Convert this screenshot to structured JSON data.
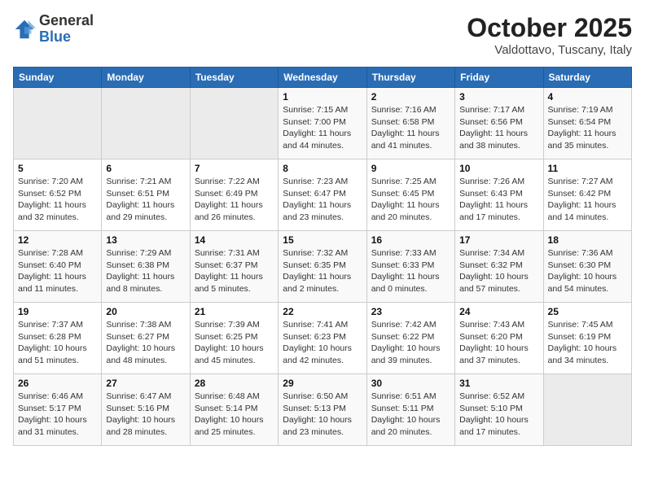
{
  "header": {
    "logo_general": "General",
    "logo_blue": "Blue",
    "month_title": "October 2025",
    "subtitle": "Valdottavo, Tuscany, Italy"
  },
  "days_of_week": [
    "Sunday",
    "Monday",
    "Tuesday",
    "Wednesday",
    "Thursday",
    "Friday",
    "Saturday"
  ],
  "weeks": [
    [
      {
        "day": "",
        "empty": true
      },
      {
        "day": "",
        "empty": true
      },
      {
        "day": "",
        "empty": true
      },
      {
        "day": "1",
        "sunrise": "7:15 AM",
        "sunset": "7:00 PM",
        "daylight": "11 hours and 44 minutes."
      },
      {
        "day": "2",
        "sunrise": "7:16 AM",
        "sunset": "6:58 PM",
        "daylight": "11 hours and 41 minutes."
      },
      {
        "day": "3",
        "sunrise": "7:17 AM",
        "sunset": "6:56 PM",
        "daylight": "11 hours and 38 minutes."
      },
      {
        "day": "4",
        "sunrise": "7:19 AM",
        "sunset": "6:54 PM",
        "daylight": "11 hours and 35 minutes."
      }
    ],
    [
      {
        "day": "5",
        "sunrise": "7:20 AM",
        "sunset": "6:52 PM",
        "daylight": "11 hours and 32 minutes."
      },
      {
        "day": "6",
        "sunrise": "7:21 AM",
        "sunset": "6:51 PM",
        "daylight": "11 hours and 29 minutes."
      },
      {
        "day": "7",
        "sunrise": "7:22 AM",
        "sunset": "6:49 PM",
        "daylight": "11 hours and 26 minutes."
      },
      {
        "day": "8",
        "sunrise": "7:23 AM",
        "sunset": "6:47 PM",
        "daylight": "11 hours and 23 minutes."
      },
      {
        "day": "9",
        "sunrise": "7:25 AM",
        "sunset": "6:45 PM",
        "daylight": "11 hours and 20 minutes."
      },
      {
        "day": "10",
        "sunrise": "7:26 AM",
        "sunset": "6:43 PM",
        "daylight": "11 hours and 17 minutes."
      },
      {
        "day": "11",
        "sunrise": "7:27 AM",
        "sunset": "6:42 PM",
        "daylight": "11 hours and 14 minutes."
      }
    ],
    [
      {
        "day": "12",
        "sunrise": "7:28 AM",
        "sunset": "6:40 PM",
        "daylight": "11 hours and 11 minutes."
      },
      {
        "day": "13",
        "sunrise": "7:29 AM",
        "sunset": "6:38 PM",
        "daylight": "11 hours and 8 minutes."
      },
      {
        "day": "14",
        "sunrise": "7:31 AM",
        "sunset": "6:37 PM",
        "daylight": "11 hours and 5 minutes."
      },
      {
        "day": "15",
        "sunrise": "7:32 AM",
        "sunset": "6:35 PM",
        "daylight": "11 hours and 2 minutes."
      },
      {
        "day": "16",
        "sunrise": "7:33 AM",
        "sunset": "6:33 PM",
        "daylight": "11 hours and 0 minutes."
      },
      {
        "day": "17",
        "sunrise": "7:34 AM",
        "sunset": "6:32 PM",
        "daylight": "10 hours and 57 minutes."
      },
      {
        "day": "18",
        "sunrise": "7:36 AM",
        "sunset": "6:30 PM",
        "daylight": "10 hours and 54 minutes."
      }
    ],
    [
      {
        "day": "19",
        "sunrise": "7:37 AM",
        "sunset": "6:28 PM",
        "daylight": "10 hours and 51 minutes."
      },
      {
        "day": "20",
        "sunrise": "7:38 AM",
        "sunset": "6:27 PM",
        "daylight": "10 hours and 48 minutes."
      },
      {
        "day": "21",
        "sunrise": "7:39 AM",
        "sunset": "6:25 PM",
        "daylight": "10 hours and 45 minutes."
      },
      {
        "day": "22",
        "sunrise": "7:41 AM",
        "sunset": "6:23 PM",
        "daylight": "10 hours and 42 minutes."
      },
      {
        "day": "23",
        "sunrise": "7:42 AM",
        "sunset": "6:22 PM",
        "daylight": "10 hours and 39 minutes."
      },
      {
        "day": "24",
        "sunrise": "7:43 AM",
        "sunset": "6:20 PM",
        "daylight": "10 hours and 37 minutes."
      },
      {
        "day": "25",
        "sunrise": "7:45 AM",
        "sunset": "6:19 PM",
        "daylight": "10 hours and 34 minutes."
      }
    ],
    [
      {
        "day": "26",
        "sunrise": "6:46 AM",
        "sunset": "5:17 PM",
        "daylight": "10 hours and 31 minutes."
      },
      {
        "day": "27",
        "sunrise": "6:47 AM",
        "sunset": "5:16 PM",
        "daylight": "10 hours and 28 minutes."
      },
      {
        "day": "28",
        "sunrise": "6:48 AM",
        "sunset": "5:14 PM",
        "daylight": "10 hours and 25 minutes."
      },
      {
        "day": "29",
        "sunrise": "6:50 AM",
        "sunset": "5:13 PM",
        "daylight": "10 hours and 23 minutes."
      },
      {
        "day": "30",
        "sunrise": "6:51 AM",
        "sunset": "5:11 PM",
        "daylight": "10 hours and 20 minutes."
      },
      {
        "day": "31",
        "sunrise": "6:52 AM",
        "sunset": "5:10 PM",
        "daylight": "10 hours and 17 minutes."
      },
      {
        "day": "",
        "empty": true
      }
    ]
  ]
}
